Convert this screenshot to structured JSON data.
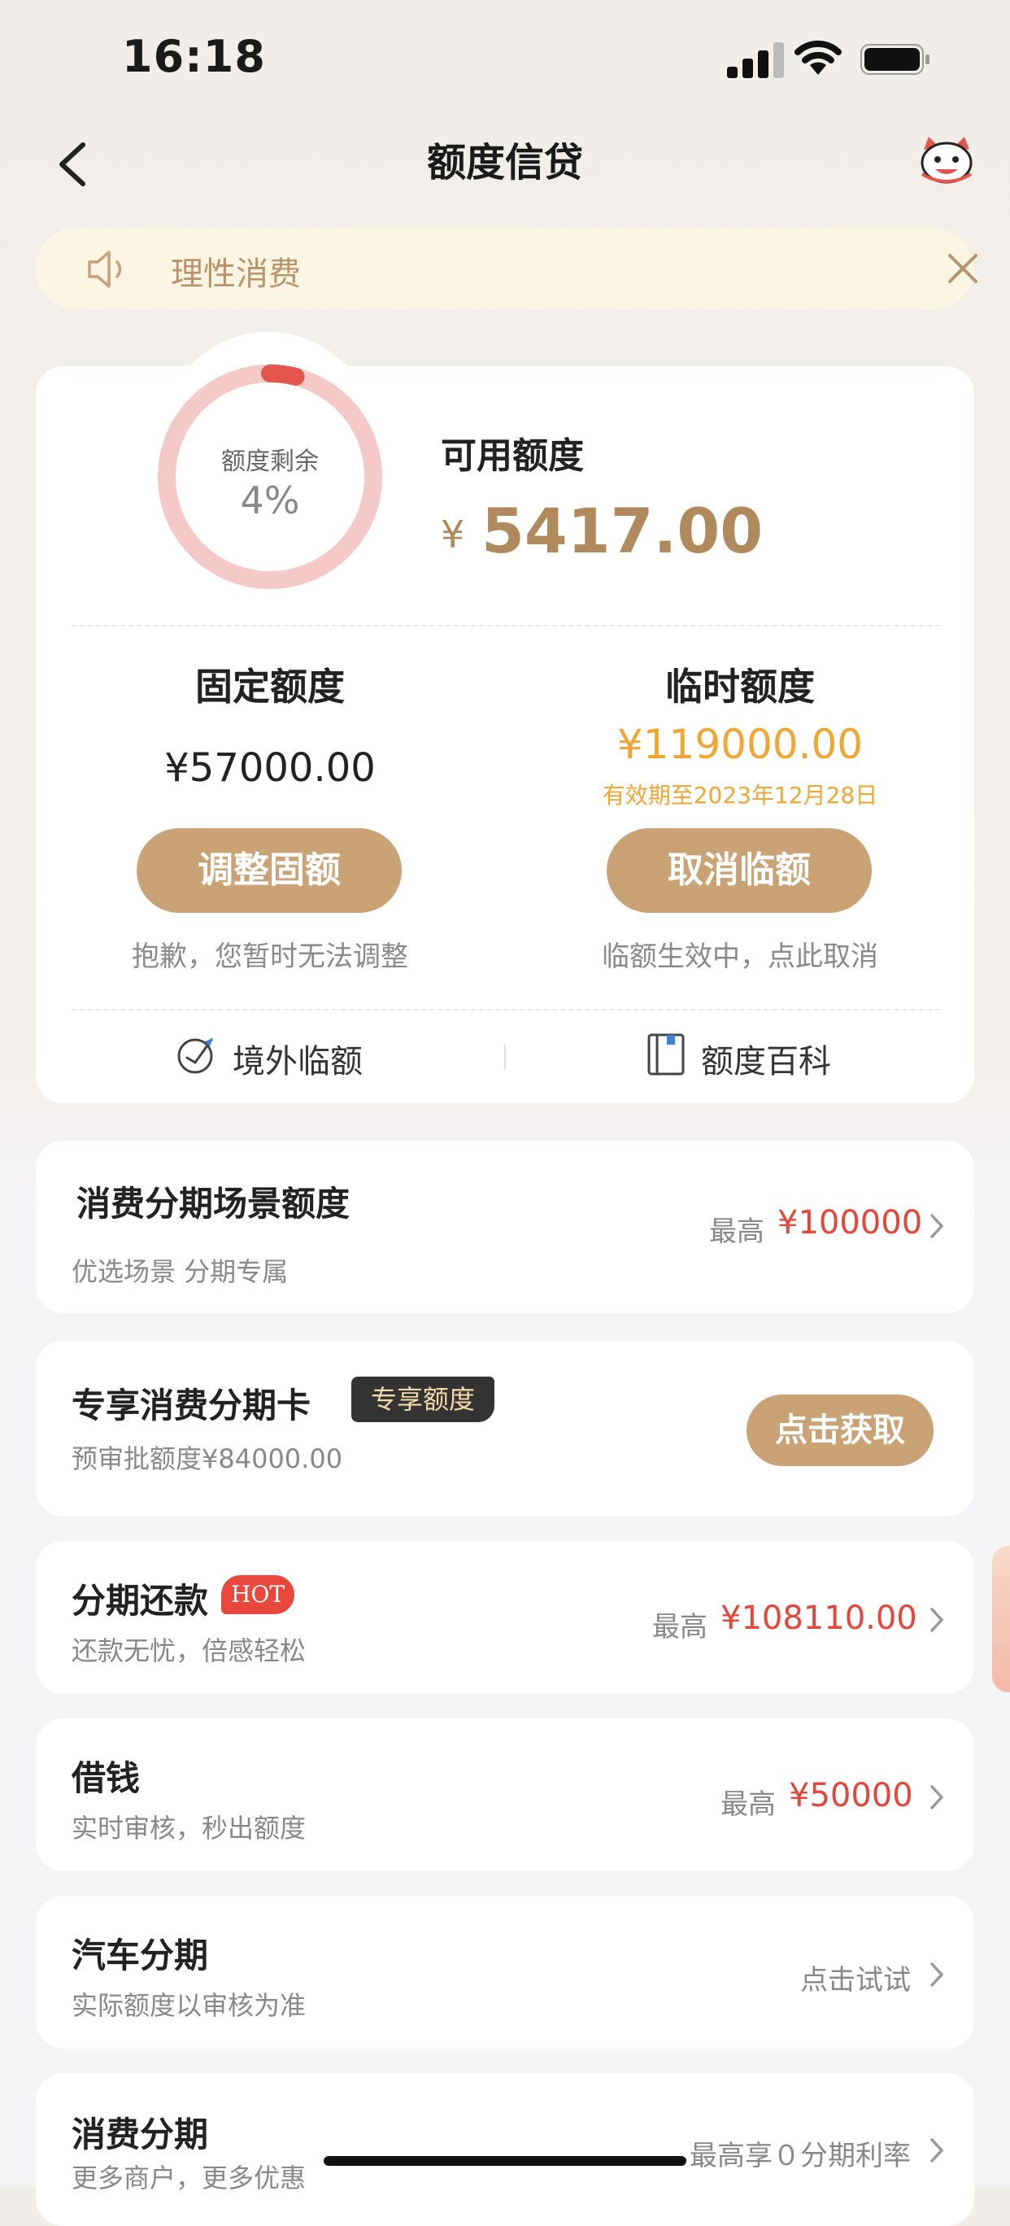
{
  "status_bar": {
    "time": "16:18"
  },
  "nav": {
    "title": "额度信贷"
  },
  "notice": {
    "text": "理性消费"
  },
  "quota": {
    "ring_label": "额度剩余",
    "ring_percent": "4%",
    "ring_fraction": 0.04,
    "available_label": "可用额度",
    "currency": "¥",
    "available_amount": "5417.00",
    "fixed_label": "固定额度",
    "fixed_amount": "¥57000.00",
    "temp_label": "临时额度",
    "temp_amount": "¥119000.00",
    "temp_valid": "有效期至2023年12月28日",
    "adjust_button": "调整固额",
    "adjust_note": "抱歉，您暂时无法调整",
    "cancel_button": "取消临额",
    "cancel_note": "临额生效中，点此取消",
    "overseas": "境外临额",
    "encyclopedia": "额度百科"
  },
  "scene_card": {
    "title": "消费分期场景额度",
    "subtitle": "优选场景 分期专属",
    "prefix": "最高",
    "amount": "¥100000"
  },
  "exclusive_card": {
    "title": "专享消费分期卡",
    "tag": "专享额度",
    "subtitle": "预审批额度¥84000.00",
    "button": "点击获取"
  },
  "list": [
    {
      "title": "分期还款",
      "badge": "HOT",
      "subtitle": "还款无忧，倍感轻松",
      "prefix": "最高",
      "amount": "¥108110.00"
    },
    {
      "title": "借钱",
      "subtitle": "实时审核，秒出额度",
      "prefix": "最高",
      "amount": "¥50000"
    },
    {
      "title": "汽车分期",
      "subtitle": "实际额度以审核为准",
      "right_text": "点击试试"
    },
    {
      "title": "消费分期",
      "subtitle": "更多商户，更多优惠",
      "right_text": "最高享０分期利率"
    }
  ],
  "colors": {
    "gold": "#c9a375",
    "accent_red": "#e6463a",
    "temp_orange": "#f2a530",
    "ring_track": "#f4c9c8",
    "ring_fill": "#e2564e"
  }
}
